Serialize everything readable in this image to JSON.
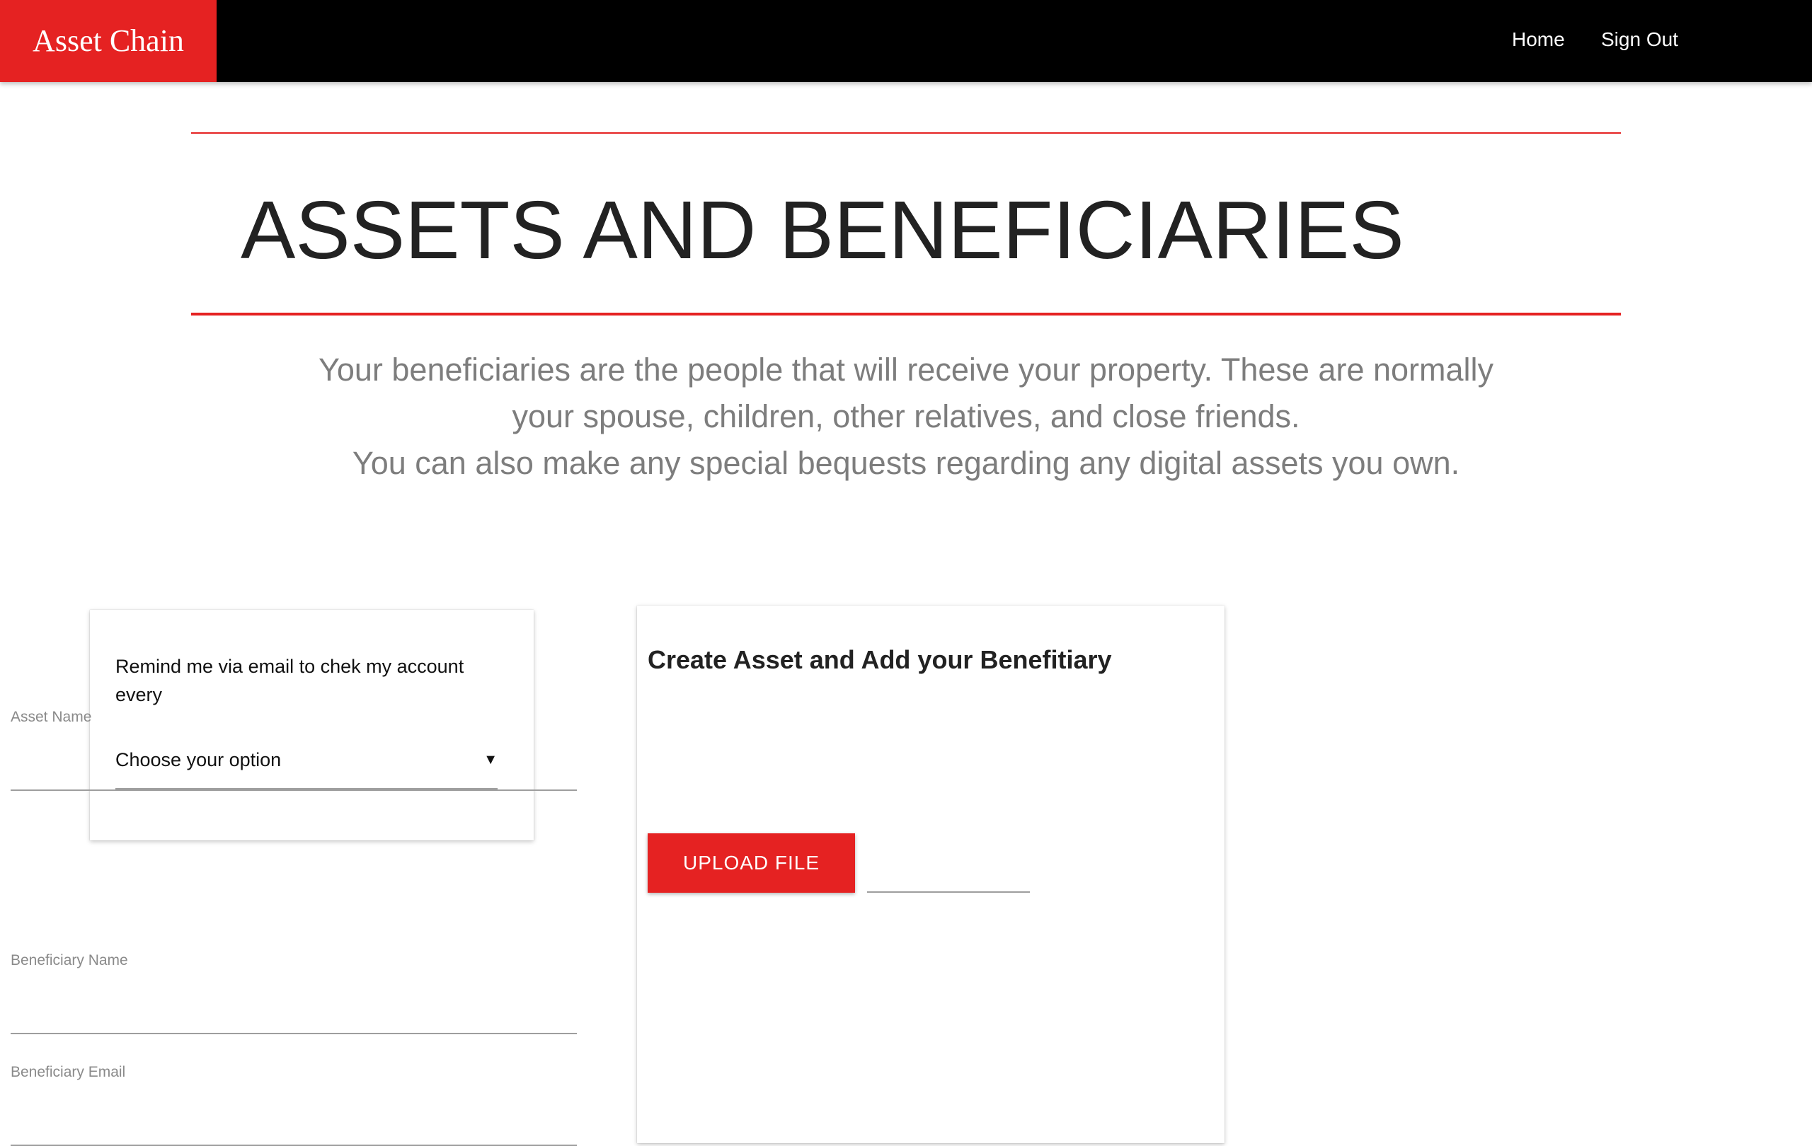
{
  "navbar": {
    "brand": "Asset Chain",
    "links": [
      {
        "label": "Home"
      },
      {
        "label": "Sign Out"
      }
    ]
  },
  "header": {
    "title": "ASSETS AND BENEFICIARIES",
    "intro_lines": [
      "Your beneficiaries are the people that will receive your property. These are normally",
      "your spouse, children, other relatives, and close friends.",
      "You can also make any special bequests regarding any digital assets you own."
    ]
  },
  "reminder_card": {
    "label": "Remind me via email to chek my account every",
    "select_value": "Choose your option",
    "select_arrow_icon": "triangle-down-icon"
  },
  "create_card": {
    "heading": "Create Asset and Add your Benefitiary",
    "asset_name_label": "Asset Name",
    "asset_name_value": "",
    "upload_label": "UPLOAD FILE",
    "file_path_value": "",
    "beneficiary_name_label": "Beneficiary Name",
    "beneficiary_name_value": "",
    "beneficiary_email_label": "Beneficiary Email",
    "beneficiary_email_value": ""
  },
  "colors": {
    "accent": "#e52222",
    "navbar": "#000000",
    "intro_text": "#7d7d7d"
  }
}
